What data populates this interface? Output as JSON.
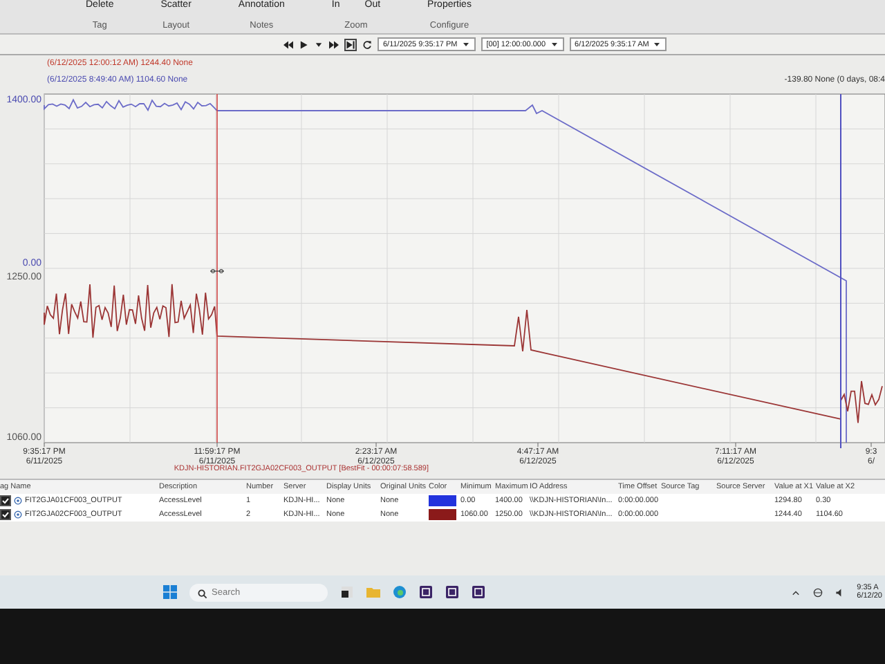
{
  "ribbon": {
    "groups": [
      {
        "label": "Tag",
        "items": [
          "Delete"
        ]
      },
      {
        "label": "Layout",
        "items": [
          "Scatter"
        ]
      },
      {
        "label": "Notes",
        "items": [
          "Annotation"
        ]
      },
      {
        "label": "Zoom",
        "items": [
          "In",
          "Out"
        ]
      },
      {
        "label": "Configure",
        "items": [
          "Properties"
        ]
      }
    ]
  },
  "toolbar": {
    "start_time": "6/11/2025  9:35:17 PM",
    "duration": "[00] 12:00:00.000",
    "end_time": "6/12/2025  9:35:17 AM"
  },
  "cursor_readouts": [
    {
      "text": "(6/12/2025 12:00:12 AM) 1244.40 None",
      "color": "#c0392b"
    },
    {
      "text": "(6/12/2025 8:49:40 AM) 1104.60 None",
      "color": "#4a4ab0"
    }
  ],
  "delta_readout": "-139.80 None (0 days, 08:4",
  "chart": {
    "y_labels": [
      {
        "text": "1400.00",
        "color": "#4a4ab0"
      },
      {
        "text": "0.00",
        "color": "#4a4ab0"
      },
      {
        "text": "1250.00",
        "color": "#555555"
      },
      {
        "text": "1060.00",
        "color": "#555555"
      }
    ],
    "x_labels": [
      [
        "9:35:17 PM",
        "6/11/2025"
      ],
      [
        "11:59:17 PM",
        "6/11/2025"
      ],
      [
        "2:23:17 AM",
        "6/12/2025"
      ],
      [
        "4:47:17 AM",
        "6/12/2025"
      ],
      [
        "7:11:17 AM",
        "6/12/2025"
      ],
      [
        "9:3",
        "6/"
      ]
    ],
    "footer": "KDJN-HISTORIAN.FIT2GJA02CF003_OUTPUT [BestFit - 00:00:07:58.589]"
  },
  "table": {
    "columns": [
      "ag Name",
      "Description",
      "Number",
      "Server",
      "Display Units",
      "Original Units",
      "Color",
      "Minimum",
      "Maximum",
      "IO Address",
      "Time Offset",
      "Source Tag",
      "Source Server",
      "Value at X1",
      "Value at X2"
    ],
    "rows": [
      {
        "checked": true,
        "tag": "FIT2GJA01CF003_OUTPUT",
        "description": "AccessLevel",
        "number": "1",
        "server": "KDJN-HI...",
        "display_units": "None",
        "original_units": "None",
        "color": "#2233dd",
        "minimum": "0.00",
        "maximum": "1400.00",
        "io_address": "\\\\KDJN-HISTORIAN\\In...",
        "time_offset": "0:00:00.000",
        "value_x1": "1294.80",
        "value_x2": "0.30"
      },
      {
        "checked": true,
        "tag": "FIT2GJA02CF003_OUTPUT",
        "description": "AccessLevel",
        "number": "2",
        "server": "KDJN-HI...",
        "display_units": "None",
        "original_units": "None",
        "color": "#8b1a1a",
        "minimum": "1060.00",
        "maximum": "1250.00",
        "io_address": "\\\\KDJN-HISTORIAN\\In...",
        "time_offset": "0:00:00.000",
        "value_x1": "1244.40",
        "value_x2": "1104.60"
      }
    ]
  },
  "taskbar": {
    "search_placeholder": "Search",
    "time": "9:35 A",
    "date": "6/12/20"
  }
}
